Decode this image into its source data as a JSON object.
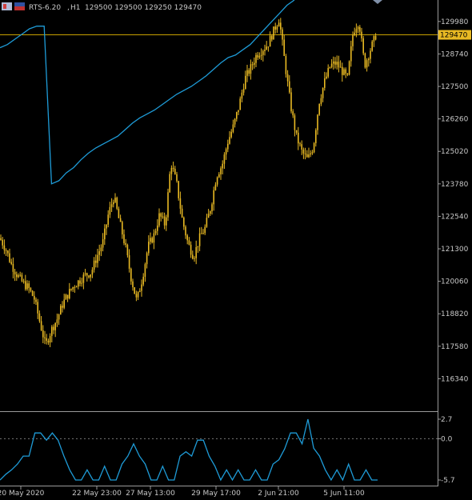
{
  "header": {
    "symbol": "RTS-6.20",
    "timeframe": "H1",
    "ohlc": "129500 129500 129250 129470",
    "flag_left": "flag-icon",
    "flag_right": "flag-icon"
  },
  "colors": {
    "background": "#000000",
    "candle": "#e8b923",
    "ma_line": "#1e9bd7",
    "price_line": "#c8a000",
    "price_tag_bg": "#e8b923",
    "price_tag_text": "#000000",
    "axis_text": "#c8c8c8",
    "indicator_line": "#1e9bd7"
  },
  "chart_data": [
    {
      "type": "candlestick",
      "title": "RTS-6.20, H1",
      "ylim": [
        115100,
        130800
      ],
      "y_ticks": [
        129980,
        128740,
        127500,
        126260,
        125020,
        123780,
        122540,
        121300,
        120060,
        118820,
        117580,
        116340
      ],
      "current_price": 129470,
      "close_path": {
        "x_range": [
          0,
          470
        ],
        "closes": [
          121700,
          121300,
          120700,
          120300,
          120000,
          119800,
          119400,
          118500,
          117600,
          118200,
          118600,
          119200,
          119600,
          119900,
          120100,
          120300,
          120400,
          121000,
          121500,
          122600,
          123300,
          122300,
          121400,
          120200,
          119300,
          120200,
          121400,
          121800,
          122600,
          122200,
          124600,
          123800,
          122400,
          121500,
          121000,
          121700,
          122100,
          122900,
          124100,
          124500,
          125400,
          126000,
          126800,
          127800,
          128200,
          128700,
          128900,
          129100,
          129600,
          130100,
          128400,
          126800,
          125600,
          125000,
          124700,
          125200,
          126900,
          127700,
          128300,
          128400,
          128100,
          127800,
          129600,
          130000,
          128300,
          128900,
          129470
        ]
      },
      "ma_series": {
        "name": "",
        "x_range": [
          0,
          368
        ],
        "values": [
          128980,
          129100,
          129300,
          129500,
          129700,
          129800,
          129800,
          123780,
          123900,
          124200,
          124400,
          124700,
          124950,
          125150,
          125300,
          125450,
          125600,
          125850,
          126100,
          126300,
          126450,
          126600,
          126800,
          127000,
          127200,
          127350,
          127500,
          127700,
          127900,
          128150,
          128400,
          128600,
          128700,
          128900,
          129100,
          129400,
          129700,
          130000,
          130300,
          130600,
          130800
        ]
      }
    },
    {
      "type": "line",
      "ylim": [
        -5.7,
        2.7
      ],
      "y_ticks": [
        2.7,
        0.0,
        -5.7
      ],
      "reference_level": 0.0,
      "x_range": [
        0,
        472
      ],
      "values": [
        -5.7,
        -4.9,
        -4.3,
        -3.5,
        -2.4,
        -2.4,
        0.8,
        0.8,
        -0.2,
        0.8,
        -0.2,
        -2.4,
        -4.3,
        -5.7,
        -5.7,
        -4.3,
        -5.7,
        -5.7,
        -3.8,
        -5.7,
        -5.7,
        -3.5,
        -2.4,
        -0.7,
        -2.4,
        -3.5,
        -5.7,
        -5.7,
        -3.8,
        -5.7,
        -5.7,
        -2.4,
        -1.8,
        -2.4,
        -0.2,
        -0.2,
        -2.4,
        -3.8,
        -5.7,
        -4.3,
        -5.7,
        -4.3,
        -5.7,
        -5.7,
        -4.3,
        -5.7,
        -5.7,
        -3.5,
        -2.9,
        -1.4,
        0.8,
        0.8,
        -0.7,
        2.7,
        -1.3,
        -2.4,
        -4.3,
        -5.7,
        -4.3,
        -5.7,
        -3.5,
        -5.7,
        -5.7,
        -4.3,
        -5.7,
        -5.7
      ]
    }
  ],
  "x_axis": {
    "labels": [
      "20 May 2020",
      "22 May 23:00",
      "27 May 13:00",
      "29 May 17:00",
      "2 Jun 21:00",
      "5 Jun 11:00"
    ]
  },
  "price_tag": "129470",
  "indicator_axis": {
    "labels": [
      "2.7",
      "0.0",
      "-5.7"
    ]
  }
}
